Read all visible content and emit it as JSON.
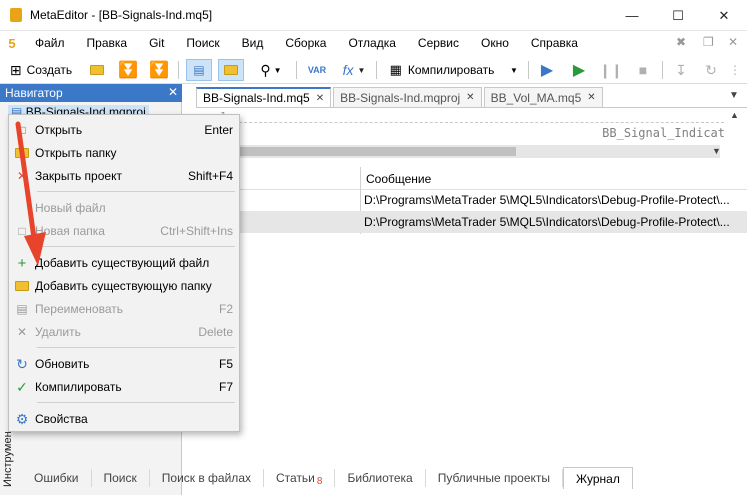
{
  "window": {
    "title": "MetaEditor - [BB-Signals-Ind.mq5]"
  },
  "menu": [
    "Файл",
    "Правка",
    "Git",
    "Поиск",
    "Вид",
    "Сборка",
    "Отладка",
    "Сервис",
    "Окно",
    "Справка"
  ],
  "toolbar": {
    "create_label": "Создать",
    "compile_label": "Компилировать",
    "var_label": "VAR",
    "fx_label": "fx"
  },
  "navigator": {
    "title": "Навигатор",
    "project": "BB-Signals-Ind.mqproj",
    "side_label": "Инструмен"
  },
  "tabs": [
    {
      "label": "BB-Signals-Ind.mq5",
      "active": true
    },
    {
      "label": "BB-Signals-Ind.mqproj",
      "active": false
    },
    {
      "label": "BB_Vol_MA.mq5",
      "active": false
    }
  ],
  "editor": {
    "line_number": "1",
    "code_fragment": "BB_Signal_Indicat"
  },
  "log": {
    "column_message": "Сообщение",
    "rows": [
      "D:\\Programs\\MetaTrader 5\\MQL5\\Indicators\\Debug-Profile-Protect\\...",
      "D:\\Programs\\MetaTrader 5\\MQL5\\Indicators\\Debug-Profile-Protect\\..."
    ]
  },
  "context_menu": {
    "items": [
      {
        "label": "Открыть",
        "shortcut": "Enter",
        "icon": "open-icon",
        "disabled": false
      },
      {
        "label": "Открыть папку",
        "shortcut": "",
        "icon": "folder-icon",
        "disabled": false
      },
      {
        "label": "Закрыть проект",
        "shortcut": "Shift+F4",
        "icon": "close-project-icon",
        "disabled": false
      },
      {
        "label": "Новый файл",
        "shortcut": "",
        "icon": "",
        "disabled": true
      },
      {
        "label": "Новая папка",
        "shortcut": "Ctrl+Shift+Ins",
        "icon": "new-folder-icon",
        "disabled": true
      },
      {
        "label": "Добавить существующий файл",
        "shortcut": "",
        "icon": "plus-icon",
        "disabled": false
      },
      {
        "label": "Добавить существующую папку",
        "shortcut": "",
        "icon": "add-folder-icon",
        "disabled": false
      },
      {
        "label": "Переименовать",
        "shortcut": "F2",
        "icon": "rename-icon",
        "disabled": true
      },
      {
        "label": "Удалить",
        "shortcut": "Delete",
        "icon": "delete-icon",
        "disabled": true
      },
      {
        "label": "Обновить",
        "shortcut": "F5",
        "icon": "refresh-icon",
        "disabled": false
      },
      {
        "label": "Компилировать",
        "shortcut": "F7",
        "icon": "check-icon",
        "disabled": false
      },
      {
        "label": "Свойства",
        "shortcut": "",
        "icon": "gear-icon",
        "disabled": false
      }
    ]
  },
  "bottom_tabs": [
    "Ошибки",
    "Поиск",
    "Поиск в файлах",
    "Статьи",
    "Библиотека",
    "Публичные проекты",
    "Журнал"
  ],
  "bottom_badge": "8",
  "colors": {
    "accent": "#3c78c8",
    "arrow": "#e8442c",
    "folder": "#f0c030",
    "green": "#2a9a3a"
  }
}
